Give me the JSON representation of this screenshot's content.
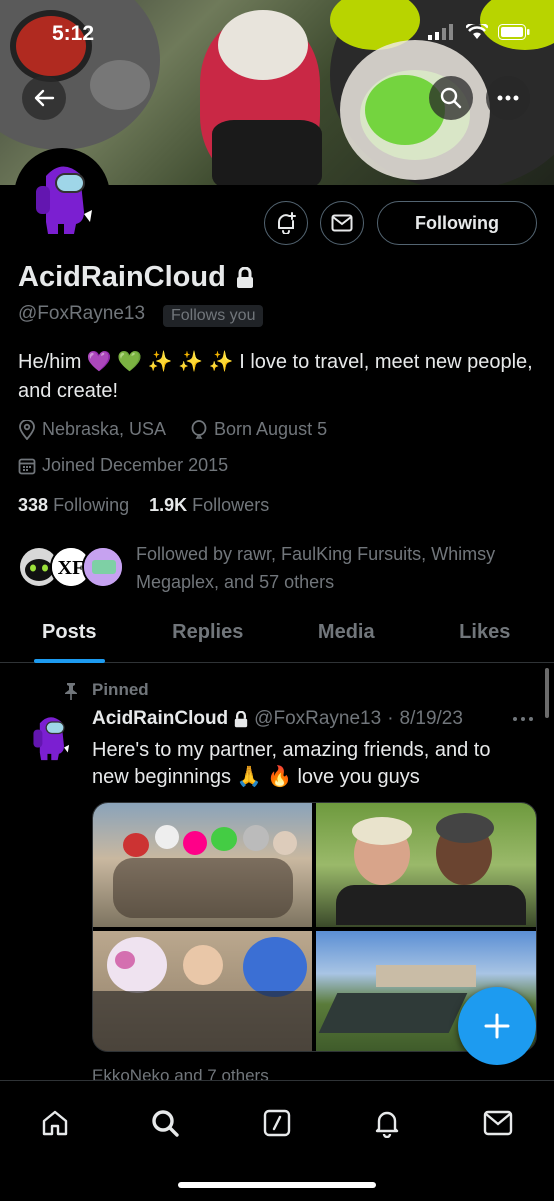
{
  "status_bar": {
    "time": "5:12"
  },
  "profile": {
    "display_name": "AcidRainCloud",
    "handle": "@FoxRayne13",
    "follows_you": "Follows you",
    "bio": "He/him 💜 💚 ✨ ✨ ✨ I love to travel, meet new people, and create!",
    "location": "Nebraska, USA",
    "birthday": "Born August 5",
    "joined": "Joined December 2015",
    "following_count": "338",
    "following_label": "Following",
    "followers_count": "1.9K",
    "followers_label": "Followers",
    "followed_by": "Followed by rawr, FaulKing Fursuits, Whimsy Megaplex, and 57 others",
    "follow_button": "Following"
  },
  "tabs": [
    {
      "label": "Posts",
      "active": true
    },
    {
      "label": "Replies",
      "active": false
    },
    {
      "label": "Media",
      "active": false
    },
    {
      "label": "Likes",
      "active": false
    }
  ],
  "pinned_post": {
    "pinned_label": "Pinned",
    "author": "AcidRainCloud",
    "handle": "@FoxRayne13",
    "date": "8/19/23",
    "separator": "·",
    "text": "Here's to my partner, amazing friends, and to new beginnings 🙏 🔥 love you guys",
    "tagged": "EkkoNeko and 7 others"
  },
  "colors": {
    "accent": "#1d9bf0",
    "muted": "#71767b",
    "text": "#e7e9ea",
    "background": "#000000"
  },
  "icons": [
    "back-arrow-icon",
    "search-icon",
    "more-icon",
    "notify-bell-plus-icon",
    "mail-icon",
    "lock-icon",
    "location-pin-icon",
    "balloon-icon",
    "calendar-icon",
    "pin-icon",
    "compose-plus-icon",
    "home-icon",
    "compose-slash-icon",
    "bell-icon"
  ]
}
